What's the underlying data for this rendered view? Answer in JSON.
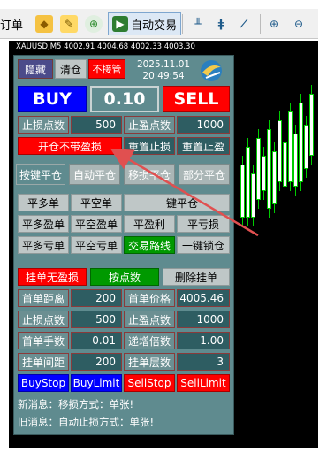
{
  "toolbar": {
    "label_left": "订单",
    "autotrade_label": "自动交易"
  },
  "chart": {
    "title": "XAUUSD,M5  4002.91 4004.68 4002.33 4003.30"
  },
  "panel": {
    "hide_button": "隐藏",
    "close_button": "清仓",
    "no_takeover_button": "不接管",
    "date": "2025.11.01",
    "time": "20:49:54",
    "buy_label": "BUY",
    "lot_value": "0.10",
    "sell_label": "SELL",
    "stoploss_label": "止损点数",
    "stoploss_value": "500",
    "takeprofit_label": "止盈点数",
    "takeprofit_value": "1000",
    "open_no_sltp_button": "开仓不带盈损",
    "reset_sl_button": "重置止损",
    "reset_tp_button": "重置止盈",
    "tabs": [
      "按键平仓",
      "自动平仓",
      "移损平仓",
      "部分平仓"
    ],
    "close_buttons": [
      [
        "平多单",
        "平空单",
        "一键平仓"
      ],
      [
        "平多盈单",
        "平空盈单",
        "平盈利",
        "平亏损"
      ],
      [
        "平多亏单",
        "平空亏单",
        "交易路线",
        "一键锁仓"
      ]
    ],
    "pending_no_sltp_button": "挂单无盈损",
    "by_points_button": "按点数",
    "delete_pending_button": "删除挂单",
    "grid": [
      {
        "l1": "首单距离",
        "v1": "200",
        "l2": "首单价格",
        "v2": "4005.46"
      },
      {
        "l1": "止损点数",
        "v1": "500",
        "l2": "止盈点数",
        "v2": "1000"
      },
      {
        "l1": "首单手数",
        "v1": "0.01",
        "l2": "递增倍数",
        "v2": "1.00"
      },
      {
        "l1": "挂单间距",
        "v1": "200",
        "l2": "挂单层数",
        "v2": "3"
      }
    ],
    "order_buttons": [
      "BuyStop",
      "BuyLimit",
      "SellStop",
      "SellLimit"
    ],
    "new_message": "新消息：移损方式：单张!",
    "old_message": "旧消息：自动止损方式：单张!"
  },
  "colors": {
    "panel_bg": "#5f8b8f",
    "buy": "#0000ff",
    "sell": "#ff0000",
    "green": "#009900",
    "arrow": "#e05050"
  },
  "icons": [
    "orders-icon",
    "chart-folder-icon",
    "signal-icon",
    "autotrade-icon",
    "bar-chart-icon",
    "candle-chart-icon",
    "line-chart-icon",
    "zoom-in-icon",
    "zoom-out-icon",
    "logo-icon"
  ]
}
